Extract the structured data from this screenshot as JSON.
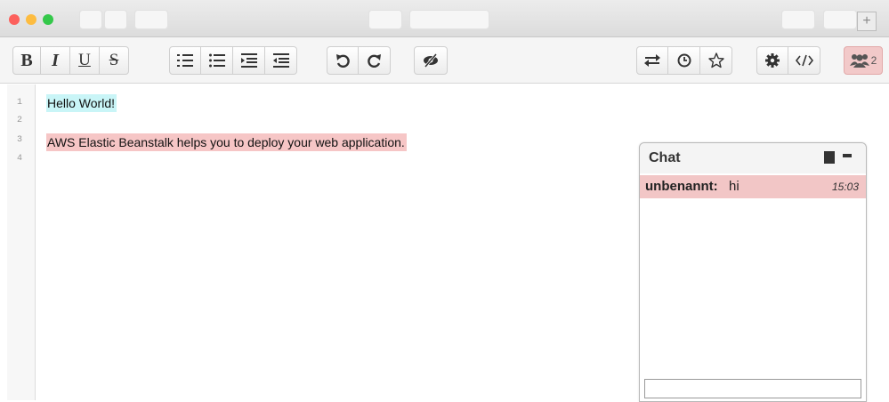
{
  "window": {
    "colors": {
      "close": "#fc605c",
      "minimize": "#fdbc40",
      "zoom": "#34c84a"
    },
    "new_tab_label": "+"
  },
  "toolbar": {
    "bold_label": "B",
    "italic_label": "I",
    "underline_label": "U",
    "strike_label": "S",
    "users_count": "2",
    "users_highlight_color": "#f2c9c9",
    "icons": [
      "ordered-list-icon",
      "unordered-list-icon",
      "indent-icon",
      "outdent-icon",
      "undo-icon",
      "redo-icon",
      "eye-slash-icon",
      "import-export-icon",
      "history-icon",
      "star-icon",
      "gear-icon",
      "code-icon",
      "users-icon"
    ]
  },
  "editor": {
    "line_numbers": [
      "1",
      "2",
      "3",
      "4"
    ],
    "lines": [
      "Hello World!",
      "",
      "AWS Elastic Beanstalk helps you to deploy your web application.",
      ""
    ],
    "highlight_colors": {
      "author_1": "#c9f5f7",
      "author_2": "#f6c6c6"
    }
  },
  "chat": {
    "title": "Chat",
    "messages": [
      {
        "author": "unbenannt:",
        "text": "hi",
        "time": "15:03"
      }
    ]
  }
}
